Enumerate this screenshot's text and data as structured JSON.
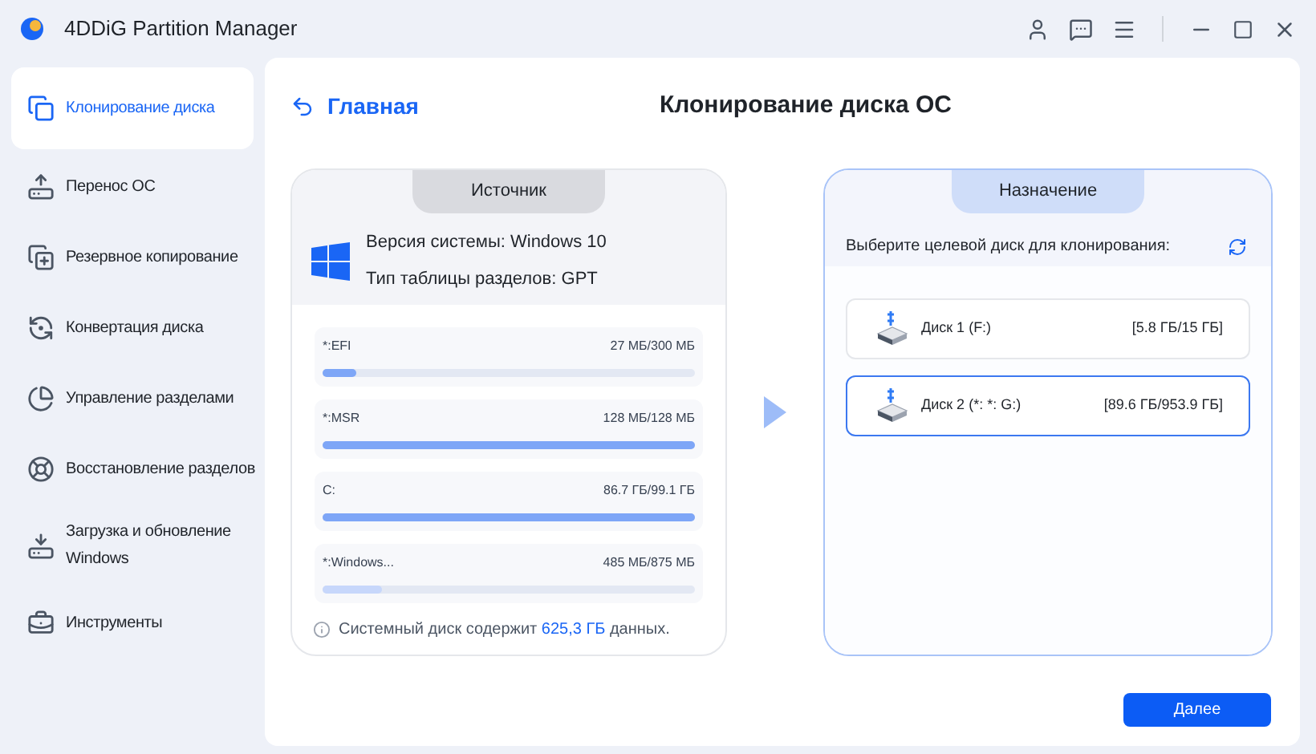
{
  "window": {
    "title": "4DDiG Partition Manager"
  },
  "sidebar": {
    "items": [
      {
        "label": "Клонирование диска",
        "selected": true
      },
      {
        "label": "Перенос ОС",
        "selected": false
      },
      {
        "label": "Резервное копирование",
        "selected": false
      },
      {
        "label": "Конвертация диска",
        "selected": false
      },
      {
        "label": "Управление разделами",
        "selected": false
      },
      {
        "label": "Восстановление разделов",
        "selected": false
      },
      {
        "label": "Загрузка и обновление Windows",
        "selected": false
      },
      {
        "label": "Инструменты",
        "selected": false
      }
    ]
  },
  "header": {
    "back_link": "Главная",
    "title": "Клонирование диска ОС"
  },
  "source": {
    "tab": "Источник",
    "os_version": "Версия системы: Windows 10",
    "partition_table": "Тип таблицы разделов: GPT",
    "partitions": [
      {
        "name": "*:EFI",
        "usage": "27 МБ/300 МБ",
        "level": 0.09
      },
      {
        "name": "*:MSR",
        "usage": "128 МБ/128 МБ",
        "level": 1
      },
      {
        "name": "C:",
        "usage": "86.7 ГБ/99.1 ГБ",
        "level": 1
      },
      {
        "name": "*:Windows...",
        "usage": "485 МБ/875 МБ",
        "level": 0.16
      }
    ],
    "note": "Системный диск содержит **625,3 ГБ** данных."
  },
  "destination": {
    "tab": "Назначение",
    "prompt": "Выберите целевой диск для клонирования:",
    "disks": [
      {
        "name": "Диск 1 (F:)",
        "usage": "[5.8 ГБ/15 ГБ]",
        "selected": false
      },
      {
        "name": "Диск 2 (*: *: G:)",
        "usage": "[89.6 ГБ/953.9 ГБ]",
        "selected": true
      }
    ]
  },
  "next_button": "Далее"
}
